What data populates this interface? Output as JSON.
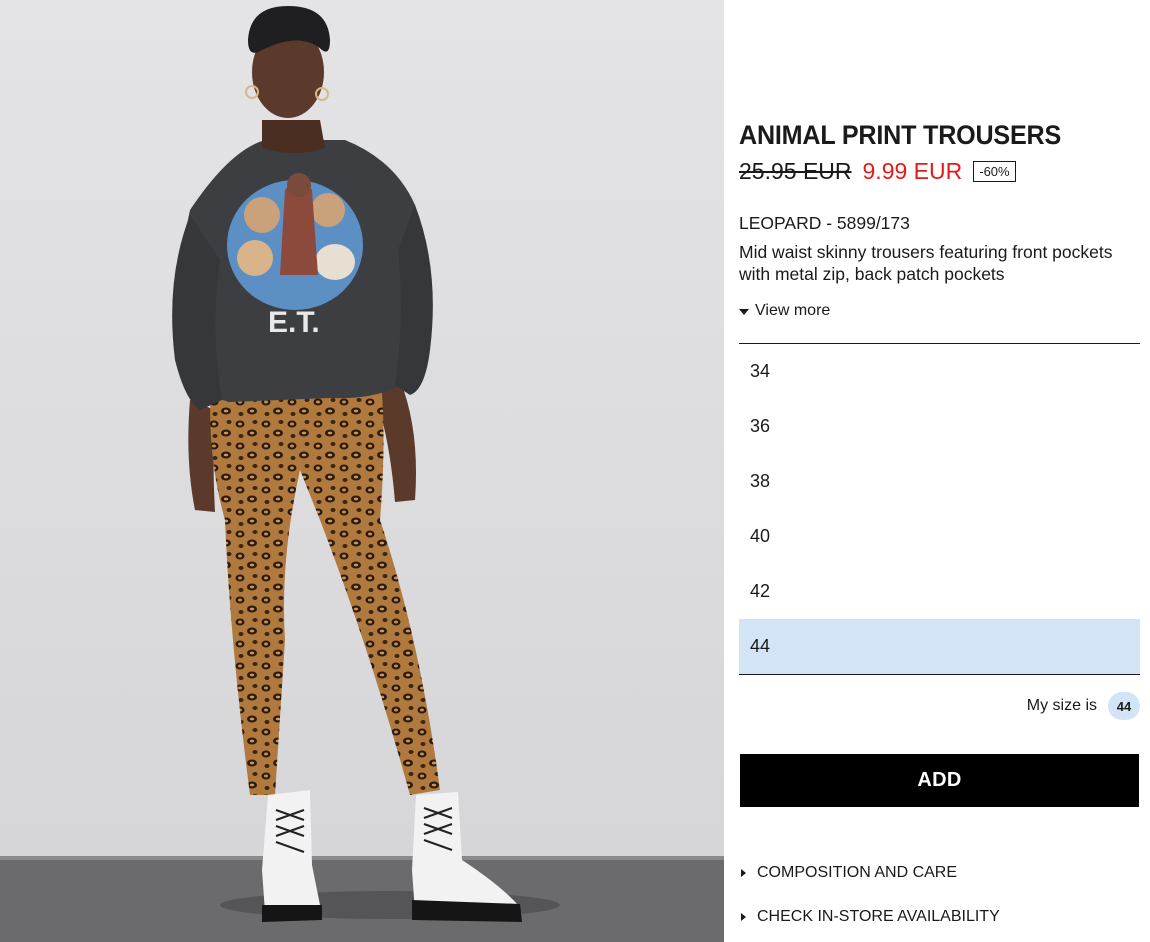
{
  "product": {
    "name": "ANIMAL PRINT TROUSERS",
    "old_price": "25.95 EUR",
    "new_price": "9.99 EUR",
    "discount": "-60%",
    "color_ref": "LEOPARD - 5899/173",
    "description": "Mid waist skinny trousers featuring front pockets with metal zip, back patch pockets",
    "view_more": "View more"
  },
  "sizes": {
    "items": [
      {
        "label": "34"
      },
      {
        "label": "36"
      },
      {
        "label": "38"
      },
      {
        "label": "40"
      },
      {
        "label": "42"
      },
      {
        "label": "44"
      }
    ],
    "selected": "44",
    "my_size_label": "My size is",
    "my_size_value": "44"
  },
  "actions": {
    "add_label": "ADD"
  },
  "links": {
    "composition": "COMPOSITION AND CARE",
    "store_availability": "CHECK IN-STORE AVAILABILITY"
  },
  "colors": {
    "price_sale": "#e21b1b",
    "selected_bg": "#d3e4f7",
    "button_bg": "#000000"
  },
  "icons": {
    "view_more": "caret-down-icon",
    "links": "caret-right-icon"
  }
}
